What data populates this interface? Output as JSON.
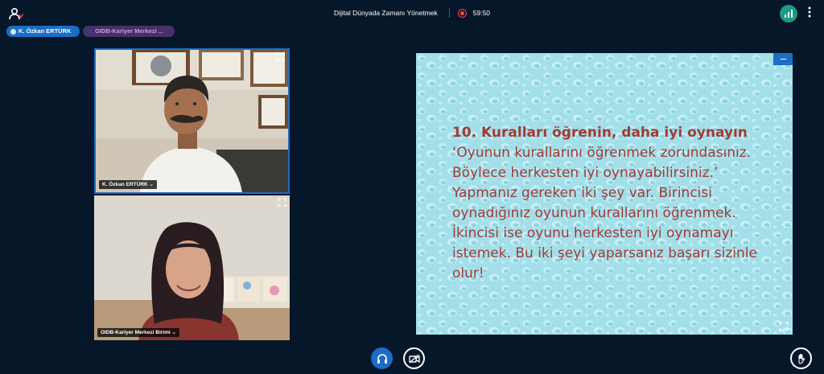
{
  "header": {
    "meeting_title": "Dijital Dünyada Zamanı Yönetmek",
    "recording_time": "59:50",
    "users_icon": "users-icon",
    "connection_icon": "signal-bars-icon",
    "more_icon": "more-vertical-icon"
  },
  "talkers": [
    {
      "name": "K. Özkan ERTÜRK",
      "color": "#1c6dc3"
    },
    {
      "name": "OIDB-Kariyer Merkezi ...",
      "color": "#4a2f6b"
    }
  ],
  "videos": [
    {
      "name": "K. Özkan ERTÜRK",
      "active": true
    },
    {
      "name": "OIDB-Kariyer Merkezi Birimi",
      "active": false
    }
  ],
  "presentation": {
    "title": "10. Kuralları öğrenin, daha iyi oynayın",
    "body": "‘Oyunun kurallarını öğrenmek zorundasınız. Böylece herkesten iyi oynayabilirsiniz.’ Yapmanız gereken iki şey var. Birincisi oynadığınız oyunun kurallarını öğrenmek. İkincisi ise oyunu herkesten iyi oynamayı istemek. Bu iki şeyi yaparsanız başarı sizinle olur!",
    "text_color": "#a13b36",
    "background_color": "#a6e2ec"
  },
  "controls": {
    "audio_icon": "headphones-icon",
    "video_icon": "video-off-icon",
    "raise_hand_icon": "raise-hand-icon",
    "accent": "#1c6dc3"
  }
}
